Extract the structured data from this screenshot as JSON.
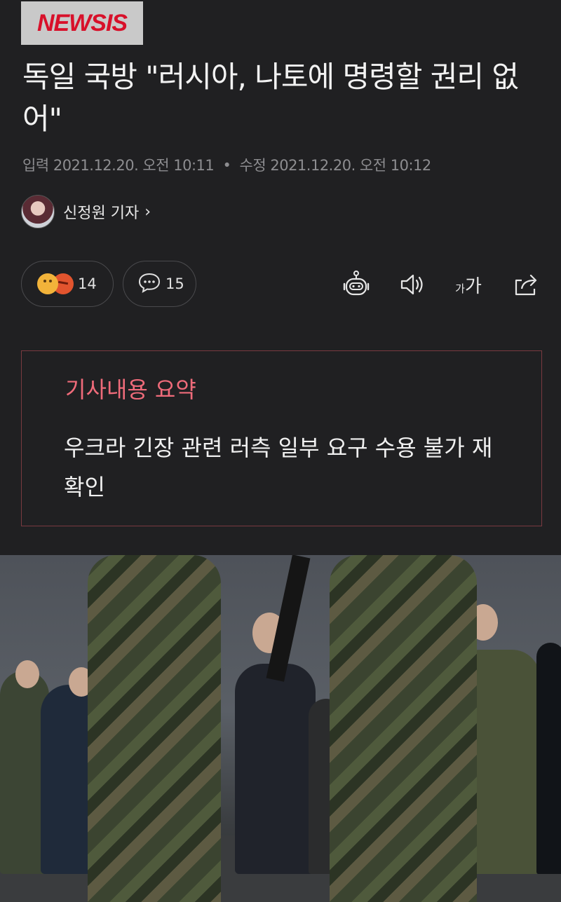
{
  "header": {
    "logo_text": "NEWSIS",
    "logo_color": "#d8102a"
  },
  "article": {
    "headline": "독일 국방 \"러시아, 나토에 명령할 권리 없어\"",
    "published_label": "입력",
    "published": "2021.12.20. 오전 10:11",
    "modified_label": "수정",
    "modified": "2021.12.20. 오전 10:12",
    "author": "신정원 기자",
    "author_chevron": "›"
  },
  "actions": {
    "reactions_count": "14",
    "comments_count": "15",
    "font_small": "가",
    "font_large": "가",
    "icons": [
      "smile-emoji-icon",
      "angry-emoji-icon",
      "comment-icon",
      "bot-icon",
      "speaker-icon",
      "font-size-icon",
      "share-icon"
    ]
  },
  "summary": {
    "title": "기사내용 요약",
    "body": "우크라 긴장 관련 러측 일부 요구 수용 불가 재확인",
    "accent_color": "#ef6b7a"
  },
  "photo": {
    "description_icon": "article-photo"
  }
}
